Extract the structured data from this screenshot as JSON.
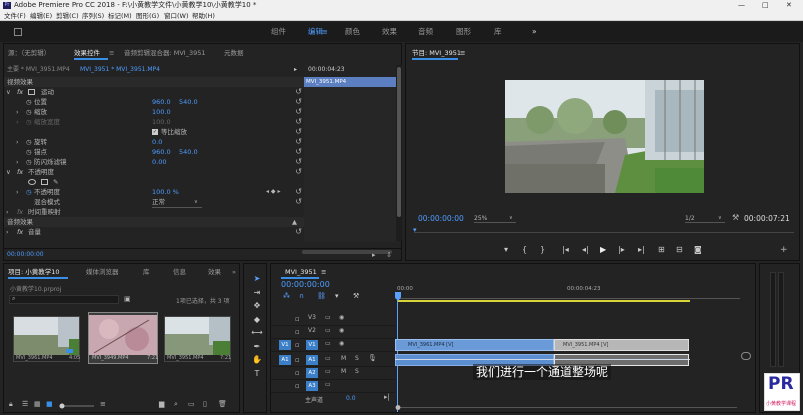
{
  "window": {
    "title": "Adobe Premiere Pro CC 2018 - F:\\小黄教学文件\\小黄教学10\\小黄教学10 *",
    "min": "—",
    "max": "□",
    "close": "✕"
  },
  "menu": [
    "文件(F)",
    "编辑(E)",
    "剪辑(C)",
    "序列(S)",
    "标记(M)",
    "图形(G)",
    "窗口(W)",
    "帮助(H)"
  ],
  "workspaces": [
    "组件",
    "编辑",
    "颜色",
    "效果",
    "音频",
    "图形",
    "库"
  ],
  "workspace_more": "»",
  "effects_panel": {
    "tabs": [
      "源：（无剪辑）",
      "效果控件",
      "音频剪辑混合器: MVI_3951",
      "元数据"
    ],
    "menu_icon": "≡",
    "master": "主要 * MVI_3951.MP4",
    "clip": "MVI_3951 * MVI_3951.MP4",
    "time": "00:00:04:23",
    "clip_bar": "MVI_3951.MP4",
    "section_video": "视频效果",
    "motion": "运动",
    "position_label": "位置",
    "position_x": "960.0",
    "position_y": "540.0",
    "scale_label": "缩放",
    "scale_value": "100.0",
    "scale_width_label": "缩放宽度",
    "scale_width_value": "100.0",
    "uniform_scale": "等比缩放",
    "rotation_label": "旋转",
    "rotation_value": "0.0",
    "anchor_label": "锚点",
    "anchor_x": "960.0",
    "anchor_y": "540.0",
    "antiflicker_label": "防闪烁滤镜",
    "antiflicker_value": "0.00",
    "opacity_section": "不透明度",
    "opacity_label": "不透明度",
    "opacity_value": "100.0 %",
    "blend_label": "混合模式",
    "blend_value": "正常",
    "time_remap": "时间重映射",
    "section_audio": "音频效果",
    "volume": "音量",
    "footer_time": "00:00:00:00"
  },
  "program": {
    "title": "节目: MVI_3951",
    "menu_icon": "≡",
    "timecode": "00:00:00:00",
    "zoom": "25%",
    "quality": "1/2",
    "duration": "00:00:07:21"
  },
  "project": {
    "tabs": [
      "项目: 小黄教学10",
      "媒体浏览器",
      "库",
      "信息",
      "效果"
    ],
    "more": "»",
    "file": "小黄教学10.prproj",
    "selection": "1项已选择，共 3 项",
    "thumbs": [
      {
        "name": "MVI_3961.MP4",
        "dur": "4:05"
      },
      {
        "name": "MVI_3949.MP4",
        "dur": "7:21"
      },
      {
        "name": "MVI_3951.MP4",
        "dur": "7:21"
      }
    ]
  },
  "timeline": {
    "tab": "MVI_3951",
    "menu_icon": "≡",
    "timecode": "00:00:00:00",
    "ruler": [
      "00:00",
      "00:00:04:23"
    ],
    "tracks_video": [
      "V3",
      "V2",
      "V1"
    ],
    "tracks_audio": [
      "A1",
      "A2",
      "A3"
    ],
    "src_v": "V1",
    "src_a": "A1",
    "master": "主声道",
    "master_val": "0.0",
    "clips": [
      {
        "label": "MVI_3961.MP4 [V]"
      },
      {
        "label": "MVI_3951.MP4 [V]"
      }
    ],
    "subtitle": "我们进行一个通道整场呢"
  },
  "logo": {
    "letters": "PR",
    "caption": "小黄教学课程"
  },
  "colors": {
    "accent": "#3a8ee6",
    "clip_blue": "#6a9ad8",
    "clip_gray": "#b7b7b7",
    "playhead": "#5aa0ff",
    "yellow": "#d8d53a"
  }
}
